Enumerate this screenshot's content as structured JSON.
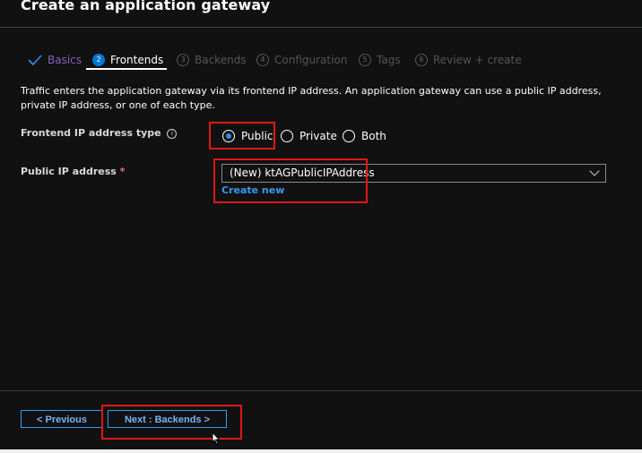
{
  "header": {
    "title": "Create an application gateway"
  },
  "tabs": [
    {
      "number": "",
      "label": "Basics",
      "state": "done"
    },
    {
      "number": "2",
      "label": "Frontends",
      "state": "active"
    },
    {
      "number": "3",
      "label": "Backends",
      "state": "disabled"
    },
    {
      "number": "4",
      "label": "Configuration",
      "state": "disabled"
    },
    {
      "number": "5",
      "label": "Tags",
      "state": "disabled"
    },
    {
      "number": "6",
      "label": "Review + create",
      "state": "disabled"
    }
  ],
  "description": "Traffic enters the application gateway via its frontend IP address. An application gateway can use a public IP address, private IP address, or one of each type.",
  "frontend_ip_type": {
    "label": "Frontend IP address type",
    "info_icon": "i",
    "options": [
      {
        "label": "Public",
        "selected": true
      },
      {
        "label": "Private",
        "selected": false
      },
      {
        "label": "Both",
        "selected": false
      }
    ]
  },
  "public_ip": {
    "label": "Public IP address",
    "required_marker": "*",
    "value": "(New) ktAGPublicIPAddress",
    "create_new": "Create new"
  },
  "footer": {
    "previous_label": "< Previous",
    "next_label": "Next : Backends >"
  },
  "colors": {
    "accent": "#0078d4",
    "link": "#3899f0",
    "highlight": "#e01717",
    "background": "#111111"
  }
}
